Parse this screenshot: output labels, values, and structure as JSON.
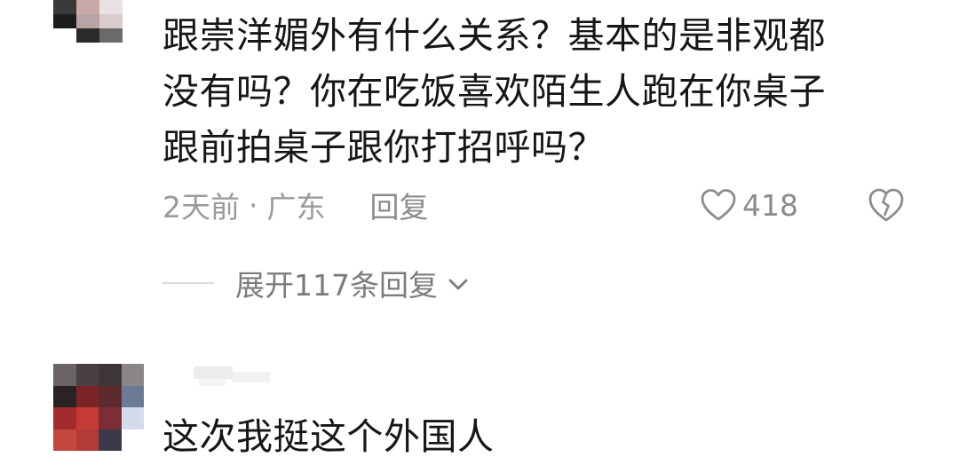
{
  "comments": [
    {
      "text_lines": [
        "跟崇洋媚外有什么关系？基本的是非观都",
        "没有吗？你在吃饭喜欢陌生人跑在你桌子",
        "跟前拍桌子跟你打招呼吗？"
      ],
      "time": "2天前",
      "separator": "·",
      "location": "广东",
      "reply_label": "回复",
      "like_count": "418",
      "expand_label": "展开117条回复",
      "icons": {
        "like": "heart-outline-icon",
        "dislike": "broken-heart-icon",
        "expand": "chevron-down-icon"
      }
    },
    {
      "text_lines": [
        "这次我挺这个外国人"
      ]
    }
  ],
  "colors": {
    "text_primary": "#161616",
    "text_meta": "#9a9a9a",
    "icon_gray": "#8c8c8c",
    "divider": "#dcdcdc"
  }
}
